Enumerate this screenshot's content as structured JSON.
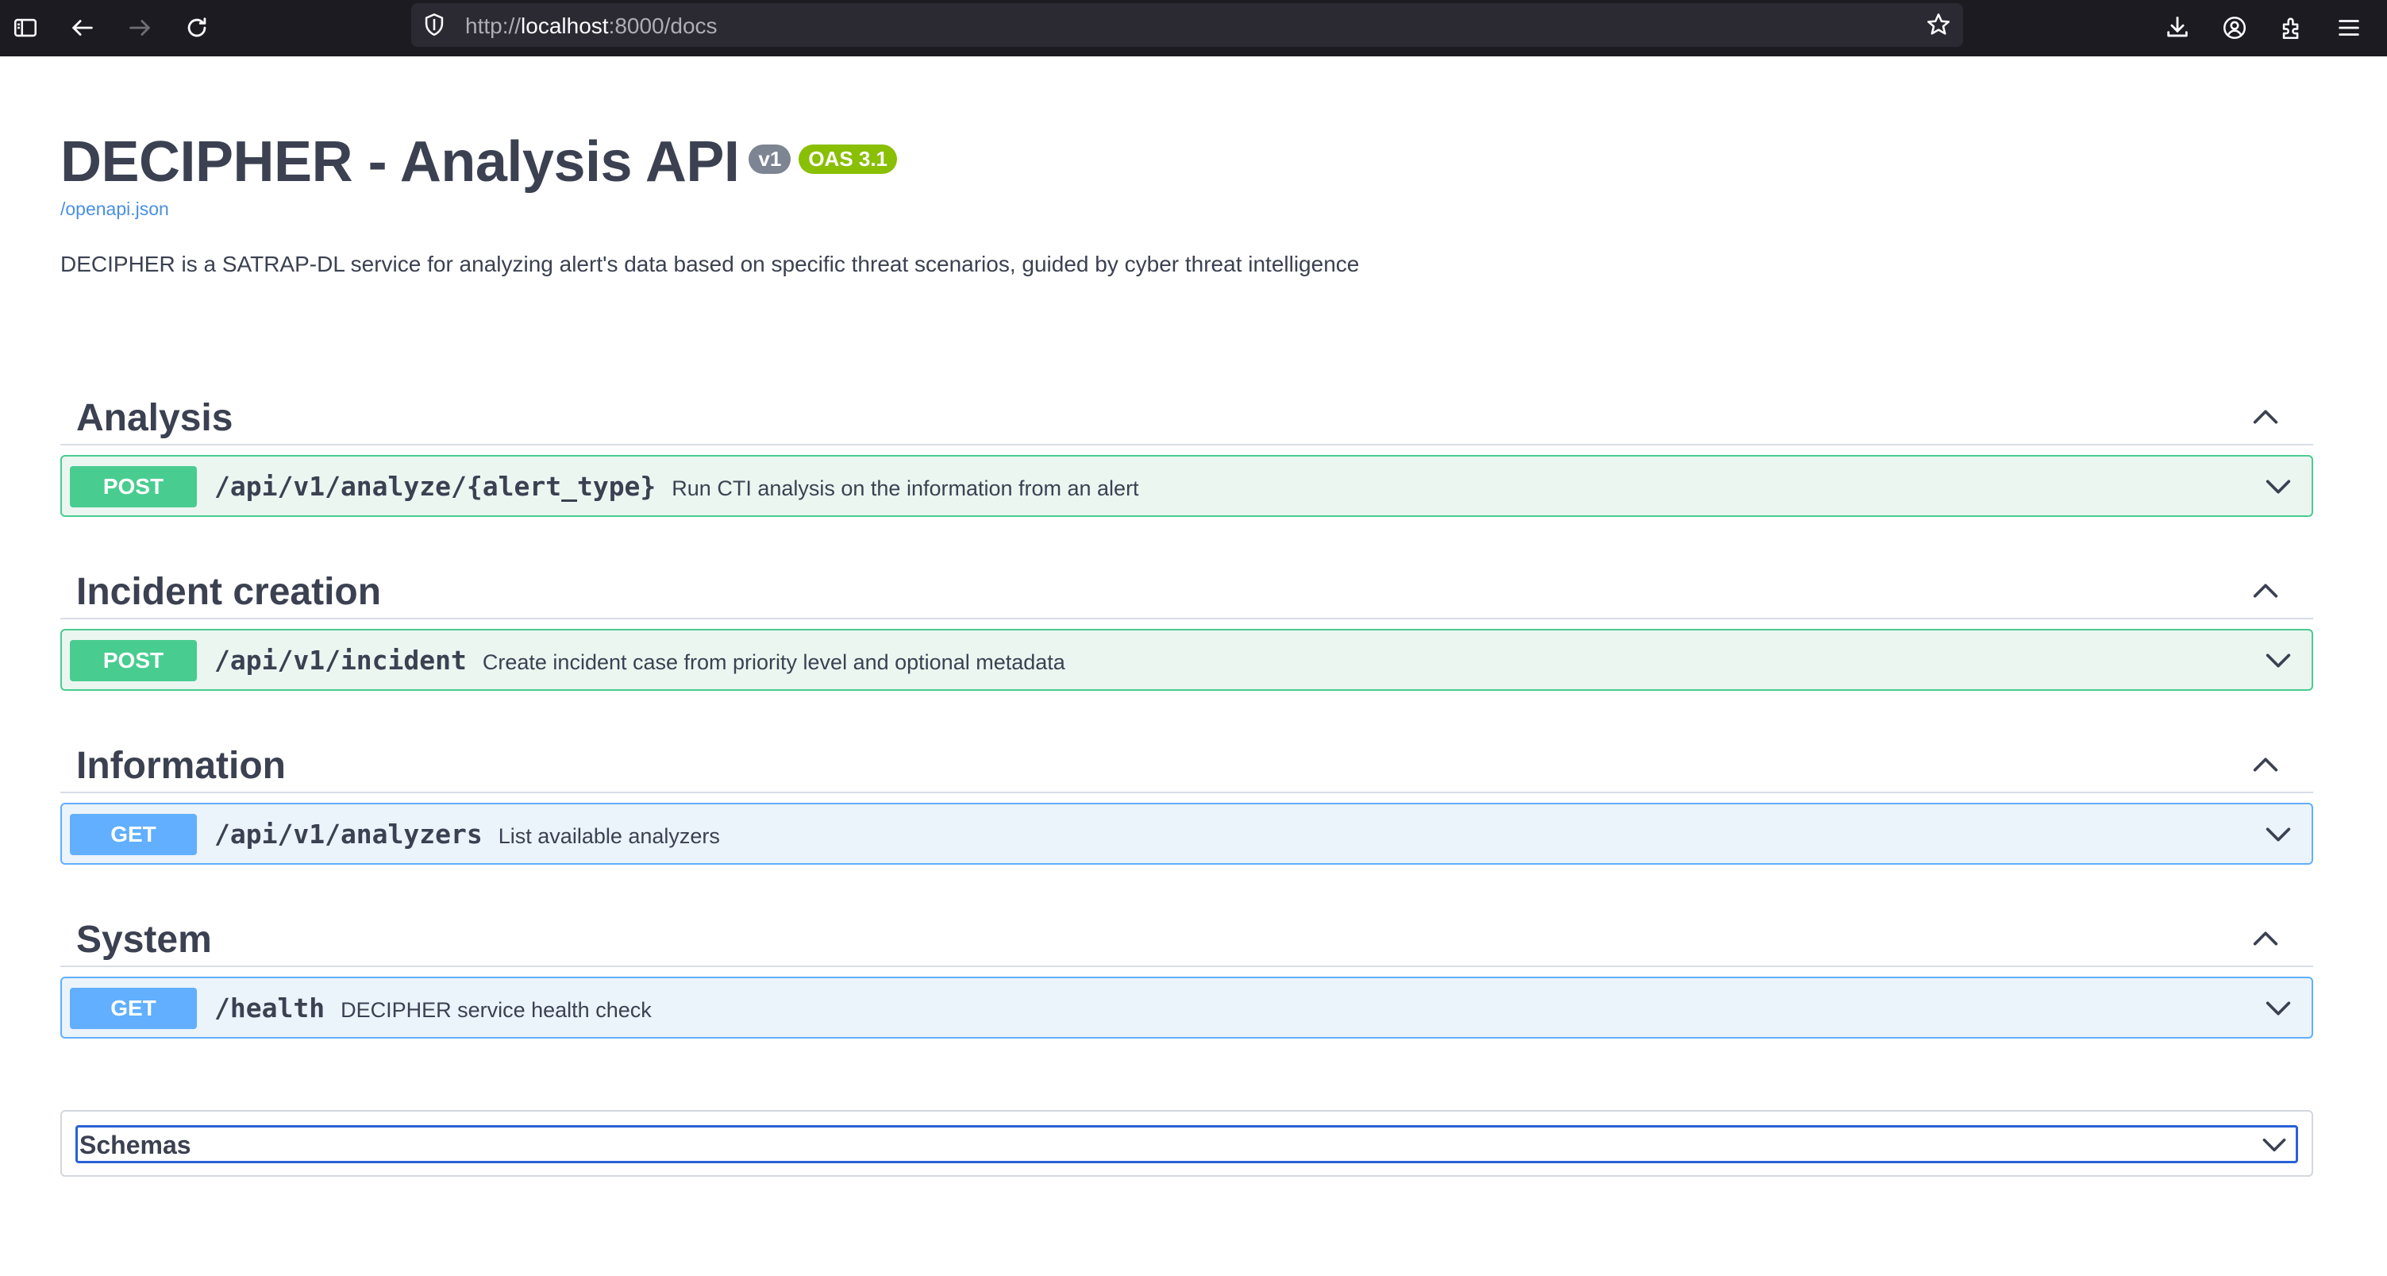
{
  "browser": {
    "url_scheme": "http://",
    "url_host": "localhost",
    "url_rest": ":8000/docs"
  },
  "api": {
    "title": "DECIPHER - Analysis API",
    "version_badge": "v1",
    "oas_badge": "OAS 3.1",
    "spec_link": "/openapi.json",
    "description": "DECIPHER is a SATRAP-DL service for analyzing alert's data based on specific threat scenarios, guided by cyber threat intelligence"
  },
  "tags": [
    {
      "name": "Analysis",
      "operation": {
        "method": "POST",
        "path": "/api/v1/analyze/{alert_type}",
        "summary": "Run CTI analysis on the information from an alert"
      }
    },
    {
      "name": "Incident creation",
      "operation": {
        "method": "POST",
        "path": "/api/v1/incident",
        "summary": "Create incident case from priority level and optional metadata"
      }
    },
    {
      "name": "Information",
      "operation": {
        "method": "GET",
        "path": "/api/v1/analyzers",
        "summary": "List available analyzers"
      }
    },
    {
      "name": "System",
      "operation": {
        "method": "GET",
        "path": "/health",
        "summary": "DECIPHER service health check"
      }
    }
  ],
  "schemas": {
    "title": "Schemas"
  },
  "colors": {
    "post": "#49cc90",
    "get": "#61affe",
    "oas": "#89bf04",
    "version": "#7d8492",
    "focus": "#2a61d5"
  }
}
